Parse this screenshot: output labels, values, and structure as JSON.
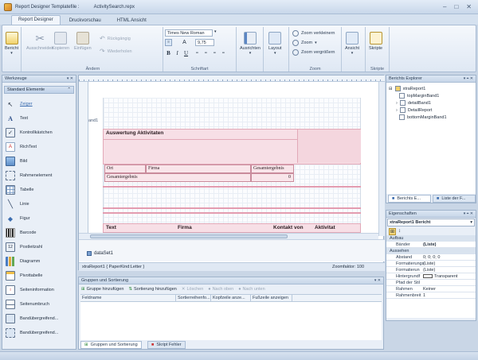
{
  "window": {
    "title_prefix": "Report Designer Templatefile :",
    "file": "ActivitySearch.repx",
    "min": "–",
    "max": "□",
    "close": "✕"
  },
  "tabs": [
    "Report Designer",
    "Druckvorschau",
    "HTML Ansicht"
  ],
  "ribbon": {
    "bericht": "Bericht",
    "ausschneiden": "Ausschneiden",
    "kopieren": "Kopieren",
    "einfuegen": "Einfügen",
    "rueckgaengig": "Rückgängig",
    "wiederholen": "Wiederholen",
    "group_aendern": "Ändern",
    "font_name": "Times New Roman",
    "font_size": "9,75",
    "group_schriftart": "Schriftart",
    "ausrichten": "Ausrichten",
    "layout": "Layout",
    "zoom_out": "Zoom verkleinern",
    "zoom": "Zoom",
    "zoom_in": "Zoom vergrößern",
    "group_zoom": "Zoom",
    "ansicht": "Ansicht",
    "skripte": "Skripte",
    "group_skripte": "Skripte"
  },
  "toolbox": {
    "title": "Werkzeuge",
    "section": "Standard Elemente",
    "items": [
      "Zeiger",
      "Text",
      "Kontrollkästchen",
      "RichText",
      "Bild",
      "Rahmenelement",
      "Tabelle",
      "Linie",
      "Figur",
      "Barcode",
      "Postleitzahl",
      "Diagramm",
      "Pivottabelle",
      "Seiteninformation",
      "Seitenumbruch",
      "Bandübergreifend...",
      "Bandübergreifend..."
    ]
  },
  "designer": {
    "band_label": "and1",
    "title_text": "Auswertung Aktivitaten",
    "row1": [
      "Ort",
      "Firma",
      "Gesamtergebnis"
    ],
    "row2": [
      "Gesamtergebnis",
      "0"
    ],
    "header": [
      "Text",
      "Firma",
      "Kontakt von",
      "Aktivitat"
    ],
    "dataset": "dataSet1",
    "status_left": "xtraReport1 { PaperKind:Letter }",
    "status_right": "Zoomfaktor: 100"
  },
  "explorer": {
    "title": "Berichts Explorer",
    "root": "xtraReport1",
    "children": [
      "topMarginBand1",
      "detailBand1",
      "DetailReport",
      "bottomMarginBand1"
    ],
    "tab1": "Berichts E...",
    "tab2": "Liste der F..."
  },
  "properties": {
    "title": "Eigenschaften",
    "object": "xtraReport1  Bericht",
    "cat1": "Aufbau",
    "baender_key": "Bänder",
    "baender_val": "(Liste)",
    "cat2": "Aussehen",
    "rows": [
      {
        "k": "Abstand",
        "v": "0; 0; 0; 0"
      },
      {
        "k": "Formatierungs",
        "v": "(Liste)"
      },
      {
        "k": "Formatierun",
        "v": "(Liste)"
      },
      {
        "k": "Hintergrundf",
        "v": "Transparent"
      },
      {
        "k": "Pfad der Stil",
        "v": ""
      },
      {
        "k": "Rahmen",
        "v": "Keiner"
      },
      {
        "k": "Rahmenbreit",
        "v": "1"
      }
    ]
  },
  "grouping": {
    "title": "Gruppen und Sortierung",
    "add_group": "Gruppe hinzufügen",
    "add_sort": "Sortierung hinzufügen",
    "delete": "Löschen",
    "up": "Nach oben",
    "down": "Nach unten",
    "columns": [
      "Feldname",
      "Sortierreihenfo...",
      "Kopfzeile anze...",
      "Fußzeile anzeigen"
    ],
    "tab1": "Gruppen und Sortierung",
    "tab2": "Skript Fehler"
  },
  "colors": {
    "accent": "#3d6eb0",
    "band": "#f7dfe6"
  }
}
